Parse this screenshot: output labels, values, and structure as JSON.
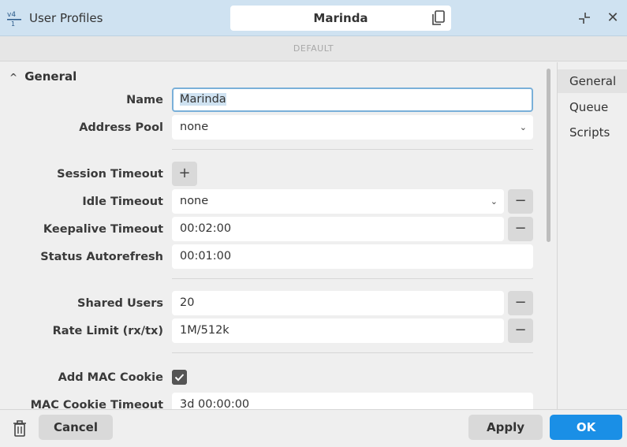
{
  "window": {
    "title": "User Profiles",
    "name_value": "Marinda",
    "subtitle": "DEFAULT",
    "close_glyph": "✕"
  },
  "icons": {
    "app": "user-profiles-icon",
    "copy": "copy-icon",
    "collapse": "collapse-icon",
    "close": "close-icon",
    "trash": "trash-icon",
    "checkbox": "checkmark-icon"
  },
  "section": {
    "title": "General",
    "caret": "^"
  },
  "form": {
    "name": {
      "label": "Name",
      "value": "Marinda"
    },
    "address_pool": {
      "label": "Address Pool",
      "value": "none"
    },
    "session_timeout": {
      "label": "Session Timeout",
      "add": "+"
    },
    "idle_timeout": {
      "label": "Idle Timeout",
      "value": "none",
      "remove": "−"
    },
    "keepalive_timeout": {
      "label": "Keepalive Timeout",
      "value": "00:02:00",
      "remove": "−"
    },
    "status_autorefresh": {
      "label": "Status Autorefresh",
      "value": "00:01:00"
    },
    "shared_users": {
      "label": "Shared Users",
      "value": "20",
      "remove": "−"
    },
    "rate_limit": {
      "label": "Rate Limit (rx/tx)",
      "value": "1M/512k",
      "remove": "−"
    },
    "add_mac_cookie": {
      "label": "Add MAC Cookie",
      "checked": true
    },
    "mac_cookie_timeout": {
      "label": "MAC Cookie Timeout",
      "value": "3d 00:00:00"
    }
  },
  "sidenav": {
    "items": [
      {
        "label": "General",
        "active": true
      },
      {
        "label": "Queue",
        "active": false
      },
      {
        "label": "Scripts",
        "active": false
      }
    ]
  },
  "footer": {
    "cancel": "Cancel",
    "apply": "Apply",
    "ok": "OK"
  },
  "colors": {
    "titlebar": "#cfe2f1",
    "accent": "#1a8fe6"
  }
}
